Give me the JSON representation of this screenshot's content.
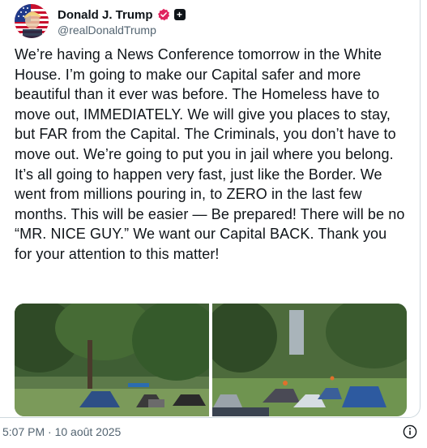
{
  "post": {
    "author": {
      "display_name": "Donald J. Trump",
      "handle": "@realDonaldTrump",
      "avatar_icon": "american-flag-portrait",
      "verified_icon": "verified-badge-icon",
      "verified_color": "#e0245e",
      "extra_badge": "+"
    },
    "text": "We’re having a News Conference tomorrow in the White House. I’m going to make our Capital safer and more beautiful than it ever was before. The Homeless have to move out, IMMEDIATELY. We will give you places to stay, but FAR from the Capital. The Criminals, you don’t have to move out. We’re going to put you in jail where you belong. It’s all going to happen very fast, just like the Border. We went from millions pouring in, to ZERO in the last few months. This will be easier — Be prepared! There will be no “MR. NICE GUY.” We want our Capital BACK. Thank you for your attention to this matter!",
    "media": [
      {
        "name": "photo-tents-under-trees",
        "kind": "photo"
      },
      {
        "name": "photo-tents-near-monument",
        "kind": "photo"
      }
    ],
    "timestamp": "5:07 PM · 10 août 2025",
    "info_icon": "info-icon"
  },
  "colors": {
    "text": "#0f1419",
    "secondary": "#536471",
    "border": "#cfd9de"
  }
}
